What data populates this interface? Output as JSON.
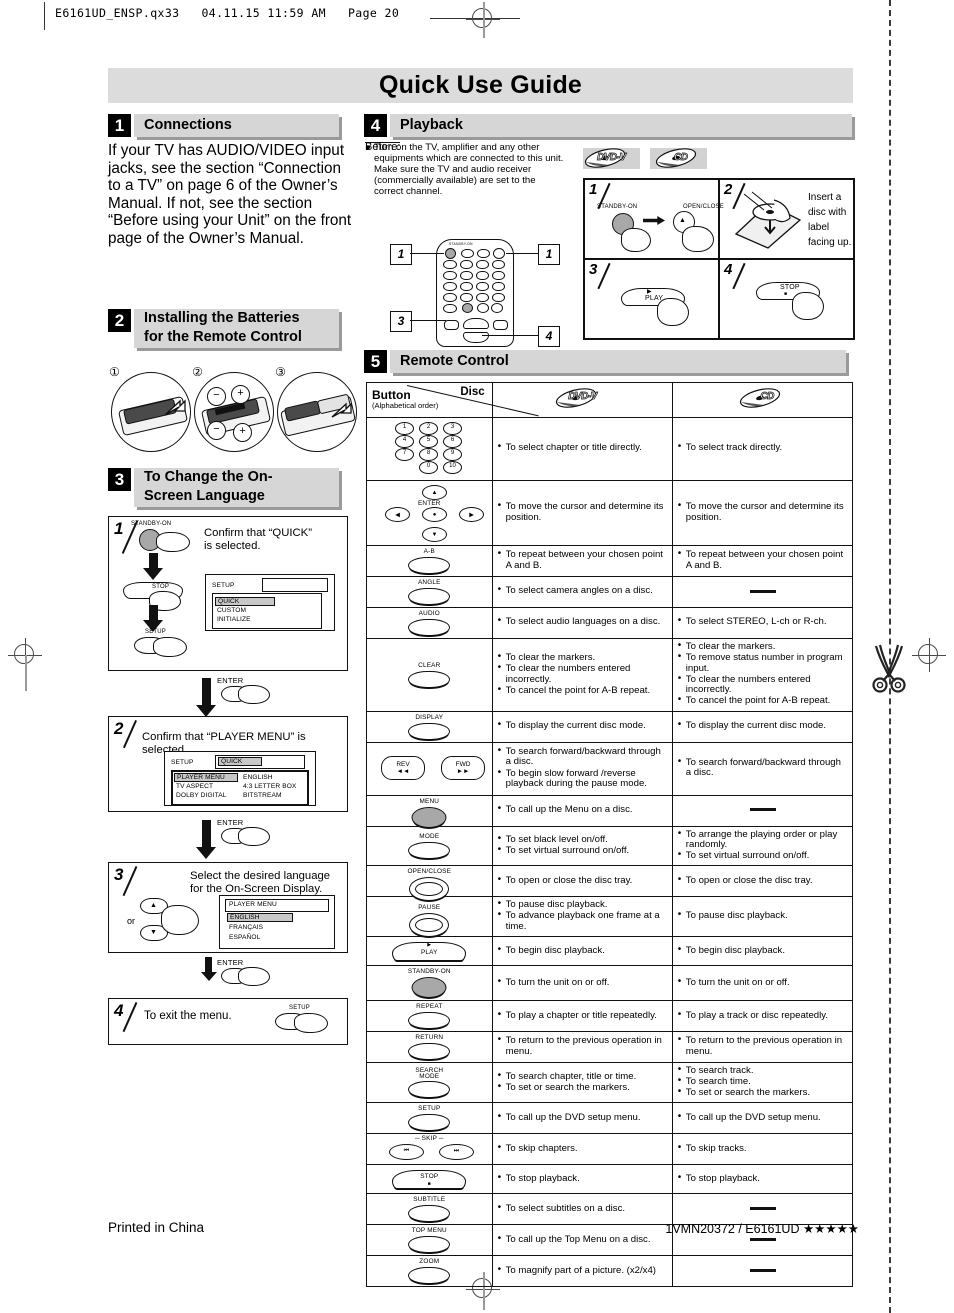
{
  "print_header": {
    "text": "E6161UD_ENSP.qx33   04.11.15 11:59 AM   Page 20"
  },
  "title": "Quick Use Guide",
  "sections": {
    "s1": {
      "number": "1",
      "label": "Connections",
      "body": "If your TV has AUDIO/VIDEO input jacks, see the section “Connection to a TV” on page 6 of the Owner’s Manual. If not, see the section “Before using your Unit” on the front page of the Owner’s Manual."
    },
    "s2": {
      "number": "2",
      "label_line1": "Installing the Batteries",
      "label_line2": "for the Remote Control",
      "steps": [
        "①",
        "②",
        "③"
      ],
      "polarity": [
        "−",
        "+",
        "−",
        "+"
      ]
    },
    "s3": {
      "number": "3",
      "label_line1": "To Change the On-",
      "label_line2": "Screen Language",
      "step1": {
        "num": "1",
        "text": "Confirm that “QUICK” is selected.",
        "buttons": [
          "STANDBY-ON",
          "STOP",
          "SETUP"
        ],
        "osd": {
          "title": "SETUP",
          "value": "",
          "items": [
            "QUICK",
            "CUSTOM",
            "INITIALIZE"
          ],
          "selected": "QUICK"
        }
      },
      "arrow1_button": "ENTER",
      "step2": {
        "num": "2",
        "text": "Confirm that “PLAYER MENU” is selected.",
        "osd": {
          "title": "SETUP",
          "value": "QUICK",
          "rows": [
            {
              "name": "PLAYER MENU",
              "value": "ENGLISH",
              "selected": true
            },
            {
              "name": "TV ASPECT",
              "value": "4:3 LETTER BOX",
              "selected": false
            },
            {
              "name": "DOLBY DIGITAL",
              "value": "BITSTREAM",
              "selected": false
            }
          ]
        }
      },
      "arrow2_button": "ENTER",
      "step3": {
        "num": "3",
        "text_line1": "Select the desired language",
        "text_line2": "for the On-Screen Display.",
        "or": "or",
        "osd": {
          "title": "PLAYER MENU",
          "items": [
            "ENGLISH",
            "FRANÇAIS",
            "ESPAÑOL"
          ],
          "selected": "ENGLISH"
        }
      },
      "arrow3_button": "ENTER",
      "step4": {
        "num": "4",
        "text": "To exit the menu.",
        "button": "SETUP"
      }
    },
    "s4": {
      "number": "4",
      "label": "Playback",
      "before_label": "Before:",
      "before_text": "Turn on the TV, amplifier and any other equipments which are connected to this unit. Make sure the TV and audio receiver (commercially available) are set to the correct channel.",
      "disc_icons": [
        "DVD-V",
        "CD"
      ],
      "remote_callouts": [
        "1",
        "1",
        "3",
        "4"
      ],
      "panels": [
        {
          "num": "1",
          "text": "",
          "buttons": [
            "STANDBY-ON",
            "OPEN/CLOSE"
          ]
        },
        {
          "num": "2",
          "text": "Insert a disc with label facing up.",
          "buttons": []
        },
        {
          "num": "3",
          "text": "",
          "buttons": [
            "PLAY"
          ]
        },
        {
          "num": "4",
          "text": "",
          "buttons": [
            "STOP"
          ]
        }
      ]
    },
    "s5": {
      "number": "5",
      "label": "Remote Control"
    }
  },
  "remote_table": {
    "header": {
      "button": "Button",
      "alpha": "(Alphabetical order)",
      "disc": "Disc",
      "col_dvd": "DVD-V",
      "col_cd": "CD"
    },
    "dash": "—",
    "rows": [
      {
        "button": "numbers",
        "kind": "numpad",
        "keys": [
          "1",
          "2",
          "3",
          "4",
          "5",
          "6",
          "7",
          "8",
          "9",
          "0",
          "10"
        ],
        "dvd": [
          "To select chapter or title directly."
        ],
        "cd": [
          "To select track directly."
        ]
      },
      {
        "button": "ENTER",
        "kind": "cursor",
        "dvd": [
          "To move the cursor and determine its position."
        ],
        "cd": [
          "To move the cursor and determine its position."
        ]
      },
      {
        "button": "A-B",
        "kind": "oval",
        "dvd": [
          "To repeat between your chosen point A and B."
        ],
        "cd": [
          "To repeat between your chosen point A and B."
        ]
      },
      {
        "button": "ANGLE",
        "kind": "oval",
        "dvd": [
          "To select camera angles on a disc."
        ],
        "cd": null
      },
      {
        "button": "AUDIO",
        "kind": "oval",
        "dvd": [
          "To select audio languages on a disc."
        ],
        "cd": [
          "To select STEREO, L-ch or R-ch."
        ]
      },
      {
        "button": "CLEAR",
        "kind": "oval",
        "dvd": [
          "To clear the markers.",
          "To clear the numbers entered incorrectly.",
          "To cancel the point for A-B repeat."
        ],
        "cd": [
          "To clear the markers.",
          "To remove status number in program input.",
          "To clear the numbers entered incorrectly.",
          "To cancel the point for A-B repeat."
        ]
      },
      {
        "button": "DISPLAY",
        "kind": "oval",
        "dvd": [
          "To display the current disc mode."
        ],
        "cd": [
          "To display the current disc mode."
        ]
      },
      {
        "button": "REV / FWD",
        "kind": "revfwd",
        "rev": "REV",
        "fwd": "FWD",
        "rev_glyph": "◄◄",
        "fwd_glyph": "►►",
        "dvd": [
          "To search forward/backward through a disc.",
          "To begin slow forward /reverse playback during the pause mode."
        ],
        "cd": [
          "To search forward/backward through a disc."
        ]
      },
      {
        "button": "MENU",
        "kind": "oval-fill",
        "dvd": [
          "To call up the Menu on a disc."
        ],
        "cd": null
      },
      {
        "button": "MODE",
        "kind": "oval",
        "dvd": [
          "To set black level on/off.",
          "To set virtual surround on/off."
        ],
        "cd": [
          "To arrange the playing order or play randomly.",
          "To set virtual surround on/off."
        ]
      },
      {
        "button": "OPEN/CLOSE",
        "kind": "oval-dbl",
        "glyph": "▲",
        "dvd": [
          "To open or close the disc tray."
        ],
        "cd": [
          "To open or close the disc tray."
        ]
      },
      {
        "button": "PAUSE",
        "kind": "oval-dbl",
        "glyph": "‖",
        "dvd": [
          "To pause disc playback.",
          "To advance playback one frame at a time."
        ],
        "cd": [
          "To pause disc playback."
        ]
      },
      {
        "button": "PLAY",
        "kind": "play",
        "glyph": "▶",
        "dvd": [
          "To begin disc playback."
        ],
        "cd": [
          "To begin disc playback."
        ]
      },
      {
        "button": "STANDBY-ON",
        "kind": "round-fill",
        "dvd": [
          "To turn the unit on or off."
        ],
        "cd": [
          "To turn the unit on or off."
        ]
      },
      {
        "button": "REPEAT",
        "kind": "oval",
        "dvd": [
          "To play a chapter or title repeatedly."
        ],
        "cd": [
          "To play a track or disc repeatedly."
        ]
      },
      {
        "button": "RETURN",
        "kind": "oval",
        "glyph": "↵",
        "dvd": [
          "To return to the previous operation in menu."
        ],
        "cd": [
          "To return to the previous operation in menu."
        ]
      },
      {
        "button": "SEARCH MODE",
        "kind": "oval2",
        "line1": "SEARCH",
        "line2": "MODE",
        "dvd": [
          "To search chapter, title or time.",
          "To set or search the markers."
        ],
        "cd": [
          "To search track.",
          "To search time.",
          "To set or search the markers."
        ]
      },
      {
        "button": "SETUP",
        "kind": "oval",
        "dvd": [
          "To call up the DVD setup menu."
        ],
        "cd": [
          "To call up the DVD setup menu."
        ]
      },
      {
        "button": "SKIP",
        "kind": "skip",
        "prev_glyph": "⏮",
        "next_glyph": "⏭",
        "dvd": [
          "To skip chapters."
        ],
        "cd": [
          "To skip tracks."
        ]
      },
      {
        "button": "STOP",
        "kind": "stop",
        "glyph": "■",
        "dvd": [
          "To stop playback."
        ],
        "cd": [
          "To stop playback."
        ]
      },
      {
        "button": "SUBTITLE",
        "kind": "oval",
        "dvd": [
          "To select subtitles on a disc."
        ],
        "cd": null
      },
      {
        "button": "TOP MENU",
        "kind": "oval",
        "dvd": [
          "To call up the Top Menu on a disc."
        ],
        "cd": null
      },
      {
        "button": "ZOOM",
        "kind": "oval",
        "dvd": [
          "To magnify part of a picture. (x2/x4)"
        ],
        "cd": null
      }
    ]
  },
  "footer": {
    "left": "Printed in China",
    "right": "1VMN20372 / E6161UD ★★★★★"
  },
  "colors": {
    "band": "#d6d6d6",
    "title_bg": "#dcdcdc",
    "num_bg": "#000000",
    "shadow": "#9a9a9a"
  }
}
